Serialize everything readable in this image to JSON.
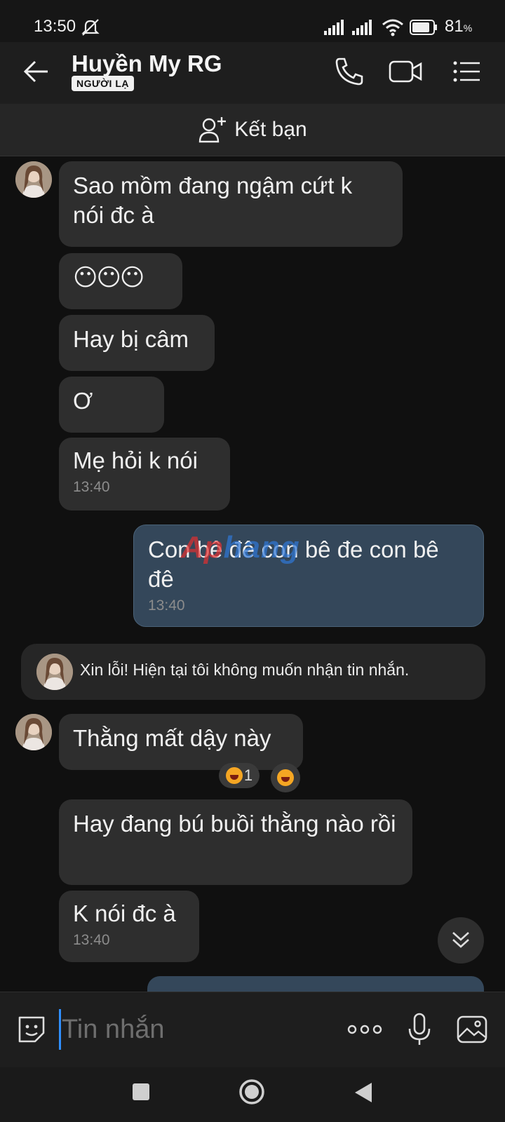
{
  "status_bar": {
    "time": "13:50",
    "battery_percent": "81",
    "battery_unit": "%"
  },
  "header": {
    "contact_name": "Huyền My RG",
    "badge": "NGƯỜI LẠ"
  },
  "friend_bar": {
    "label": "Kết bạn"
  },
  "messages": {
    "m1": "Sao mồm đang ngậm cứt k nói đc à",
    "m2_emoji": "😶😶😶",
    "m3": "Hay bị câm",
    "m4": "Ơ",
    "m5": "Mẹ hỏi k nói",
    "m5_time": "13:40",
    "m6_mine": "Con bê đê con bê đe con bê đê",
    "m6_time": "13:40",
    "system_notice": "Xin lỗi! Hiện tại tôi không muốn nhận tin nhắn.",
    "m7": "Thằng mất dậy này",
    "m7_reaction_count": "1",
    "m8": "Hay đang bú buồi thằng nào rồi",
    "m9": "K nói đc à",
    "m9_time": "13:40"
  },
  "watermark": {
    "part1": "Ap",
    "part2": "hang"
  },
  "input": {
    "placeholder": "Tin nhắn"
  },
  "colors": {
    "bubble_incoming": "#2e2e2e",
    "bubble_outgoing": "#34475a",
    "accent": "#2f8fff",
    "background": "#101010"
  },
  "icons": [
    "back-arrow-icon",
    "phone-icon",
    "video-call-icon",
    "menu-list-icon",
    "add-friend-icon",
    "sticker-icon",
    "more-dots-icon",
    "microphone-icon",
    "image-icon",
    "scroll-down-icon"
  ]
}
